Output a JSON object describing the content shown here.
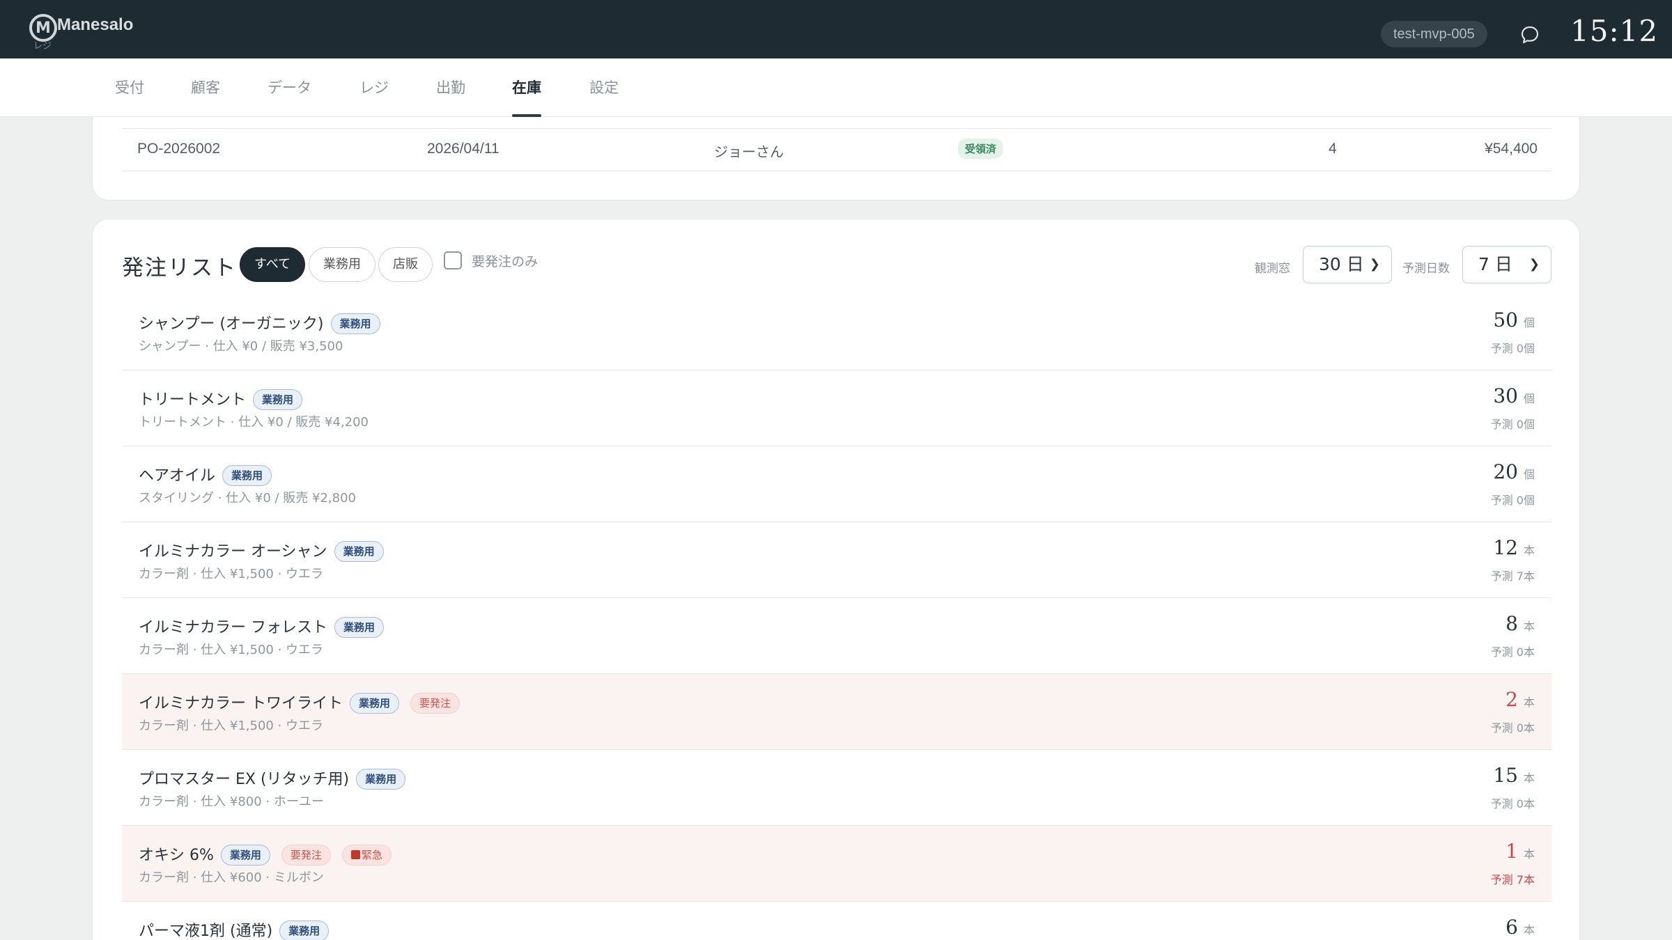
{
  "header": {
    "app_name": "Manesalo",
    "app_sub": "レジ",
    "logo_glyph": "M",
    "tenant": "test-mvp-005",
    "clock": "15:12",
    "icons": [
      "chat-icon"
    ],
    "colors": {
      "bar": "#1f2b33",
      "accent": "#c44a45"
    }
  },
  "nav": {
    "tabs": [
      "受付",
      "顧客",
      "データ",
      "レジ",
      "出勤",
      "在庫",
      "設定"
    ],
    "active": "在庫"
  },
  "po": {
    "id": "PO-2026002",
    "date": "2026/04/11",
    "person": "ジョーさん",
    "status": "受領済",
    "count": "4",
    "amount": "¥54,400"
  },
  "orders": {
    "title": "発注リスト",
    "filters": [
      "すべて",
      "業務用",
      "店販"
    ],
    "active_filter": "すべて",
    "only_required_label": "要発注のみ",
    "only_required_checked": false,
    "window_label": "観測窓",
    "window_value": "30 日",
    "forecast_label": "予測日数",
    "forecast_value": "7 日",
    "items": [
      {
        "name": "シャンプー (オーガニック)",
        "tag": "業務用",
        "required": "",
        "urgent": "",
        "sub": "シャンプー · 仕入 ¥0 / 販売 ¥3,500",
        "qty": "50",
        "unit": "個",
        "forecast": "予測 0個"
      },
      {
        "name": "トリートメント",
        "tag": "業務用",
        "required": "",
        "urgent": "",
        "sub": "トリートメント · 仕入 ¥0 / 販売 ¥4,200",
        "qty": "30",
        "unit": "個",
        "forecast": "予測 0個"
      },
      {
        "name": "ヘアオイル",
        "tag": "業務用",
        "required": "",
        "urgent": "",
        "sub": "スタイリング · 仕入 ¥0 / 販売 ¥2,800",
        "qty": "20",
        "unit": "個",
        "forecast": "予測 0個"
      },
      {
        "name": "イルミナカラー オーシャン",
        "tag": "業務用",
        "required": "",
        "urgent": "",
        "sub": "カラー剤 · 仕入 ¥1,500 · ウエラ",
        "qty": "12",
        "unit": "本",
        "forecast": "予測 7本"
      },
      {
        "name": "イルミナカラー フォレスト",
        "tag": "業務用",
        "required": "",
        "urgent": "",
        "sub": "カラー剤 · 仕入 ¥1,500 · ウエラ",
        "qty": "8",
        "unit": "本",
        "forecast": "予測 0本"
      },
      {
        "name": "イルミナカラー トワイライト",
        "tag": "業務用",
        "required": "要発注",
        "urgent": "",
        "sub": "カラー剤 · 仕入 ¥1,500 · ウエラ",
        "qty": "2",
        "unit": "本",
        "forecast": "予測 0本"
      },
      {
        "name": "プロマスター EX (リタッチ用)",
        "tag": "業務用",
        "required": "",
        "urgent": "",
        "sub": "カラー剤 · 仕入 ¥800 · ホーユー",
        "qty": "15",
        "unit": "本",
        "forecast": "予測 0本"
      },
      {
        "name": "オキシ 6%",
        "tag": "業務用",
        "required": "要発注",
        "urgent": "緊急",
        "sub": "カラー剤 · 仕入 ¥600 · ミルボン",
        "qty": "1",
        "unit": "本",
        "forecast": "予測 7本"
      },
      {
        "name": "パーマ液1剤 (通常)",
        "tag": "業務用",
        "required": "",
        "urgent": "",
        "sub": "",
        "qty": "6",
        "unit": "本",
        "forecast": ""
      }
    ]
  }
}
